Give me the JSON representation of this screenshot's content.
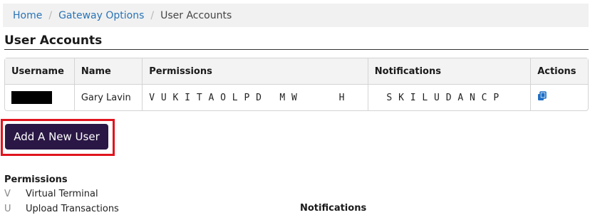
{
  "breadcrumb": {
    "items": [
      "Home",
      "Gateway Options"
    ],
    "current": "User Accounts"
  },
  "page_title": "User Accounts",
  "table": {
    "columns": [
      "Username",
      "Name",
      "Permissions",
      "Notifications",
      "Actions"
    ],
    "rows": [
      {
        "username": "",
        "name": "Gary Lavin",
        "permissions": "V U K I T A O L P D   M W       H",
        "notifications": "  S K I L U D A N C P",
        "action_icon": "copy-icon"
      }
    ]
  },
  "add_user_button": "Add A New User",
  "permissions_section": {
    "heading": "Permissions",
    "items": [
      {
        "code": "V",
        "label": "Virtual Terminal"
      },
      {
        "code": "U",
        "label": "Upload Transactions"
      }
    ]
  },
  "notifications_section": {
    "heading": "Notifications"
  },
  "colors": {
    "link": "#2a74b5",
    "button_bg": "#2a1745",
    "highlight": "#e0141e"
  }
}
